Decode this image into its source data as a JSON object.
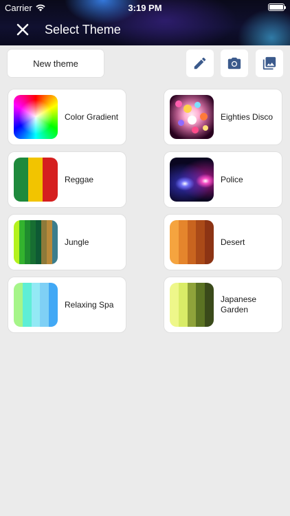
{
  "status_bar": {
    "carrier": "Carrier",
    "time": "3:19 PM"
  },
  "nav": {
    "title": "Select Theme",
    "close_icon": "close-icon"
  },
  "toolbar": {
    "new_theme_label": "New theme",
    "icons": [
      "pencil-icon",
      "camera-icon",
      "photo-library-icon"
    ],
    "icon_color": "#3b5a8c"
  },
  "themes": [
    {
      "name": "Color Gradient"
    },
    {
      "name": "Eighties Disco"
    },
    {
      "name": "Reggae",
      "colors": [
        "#1e8a3c",
        "#f2c400",
        "#d51f1f"
      ]
    },
    {
      "name": "Police"
    },
    {
      "name": "Jungle",
      "colors": [
        "#b4f21e",
        "#33b32e",
        "#1f8c2e",
        "#176e32",
        "#0e5a34",
        "#8e7a3a",
        "#b8893a",
        "#3b7d8c"
      ]
    },
    {
      "name": "Desert",
      "colors": [
        "#f5a43f",
        "#e5852c",
        "#c9641f",
        "#aa4a18",
        "#8c3414"
      ]
    },
    {
      "name": "Relaxing Spa",
      "colors": [
        "#a6f589",
        "#5eeed6",
        "#93e9f5",
        "#7fd0f5",
        "#41a8f5"
      ]
    },
    {
      "name": "Japanese\nGarden",
      "colors": [
        "#eef78a",
        "#d9ec67",
        "#8fa33a",
        "#5b7323",
        "#3a4a1a"
      ]
    }
  ],
  "colors": {
    "background": "#ebebeb",
    "card": "#ffffff"
  }
}
